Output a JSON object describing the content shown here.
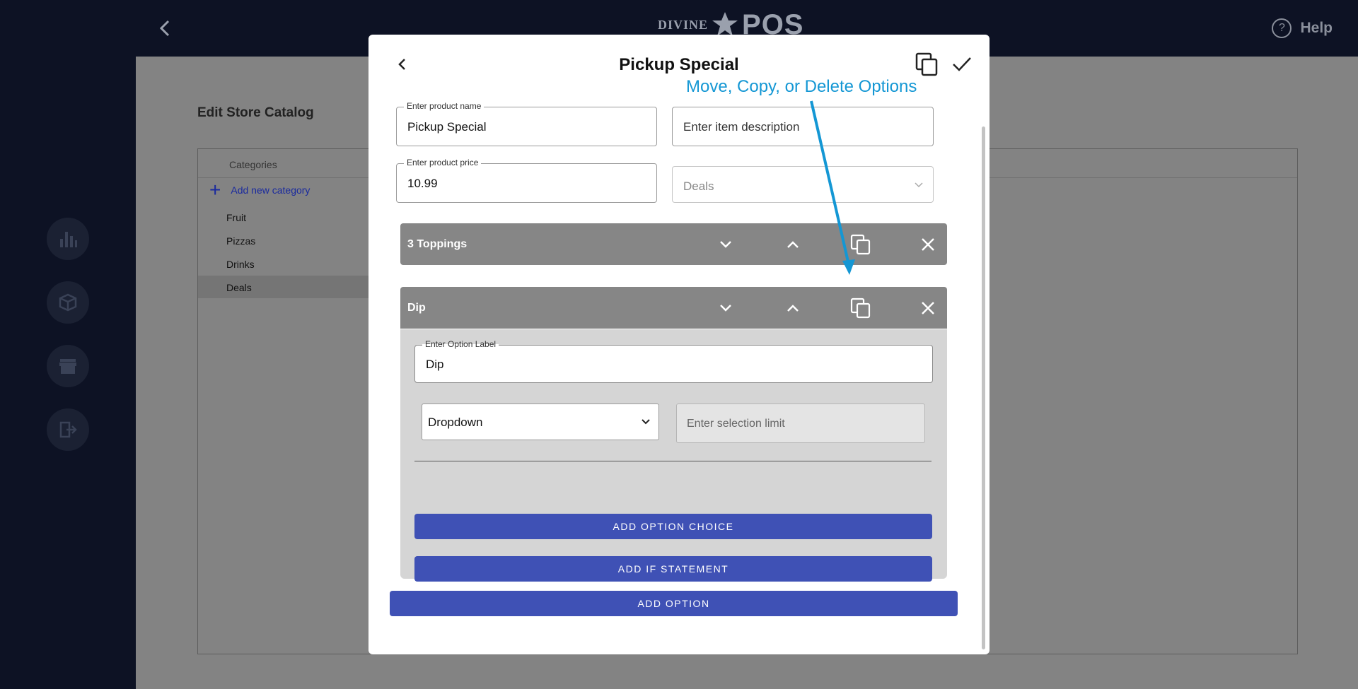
{
  "app": {
    "logo_word": "DIVINE",
    "logo_pos": "POS",
    "help_label": "Help"
  },
  "catalog": {
    "title": "Edit Store Catalog",
    "categories_header": "Categories",
    "add_category_label": "Add new category",
    "categories": [
      "Fruit",
      "Pizzas",
      "Drinks",
      "Deals"
    ],
    "active_category": "Deals"
  },
  "modal": {
    "title": "Pickup Special",
    "annotation": "Move, Copy, or Delete Options",
    "product_name": {
      "label": "Enter product name",
      "value": "Pickup Special"
    },
    "item_description": {
      "placeholder": "Enter item description"
    },
    "product_price": {
      "label": "Enter product price",
      "value": "10.99"
    },
    "category_select": {
      "value": "Deals"
    },
    "options": [
      {
        "name": "3 Toppings",
        "expanded": false
      },
      {
        "name": "Dip",
        "expanded": true,
        "option_label": {
          "label": "Enter Option Label",
          "value": "Dip"
        },
        "type_select": {
          "value": "Dropdown"
        },
        "selection_limit": {
          "placeholder": "Enter selection limit"
        },
        "add_choice_label": "ADD OPTION CHOICE",
        "add_if_label": "ADD IF STATEMENT"
      }
    ],
    "add_option_label": "ADD OPTION"
  },
  "colors": {
    "nav_bg": "#0d1224",
    "overlay_bg": "#838383",
    "primary_button": "#3f51b5",
    "option_bar": "#868686",
    "annotation": "#1497d4"
  }
}
